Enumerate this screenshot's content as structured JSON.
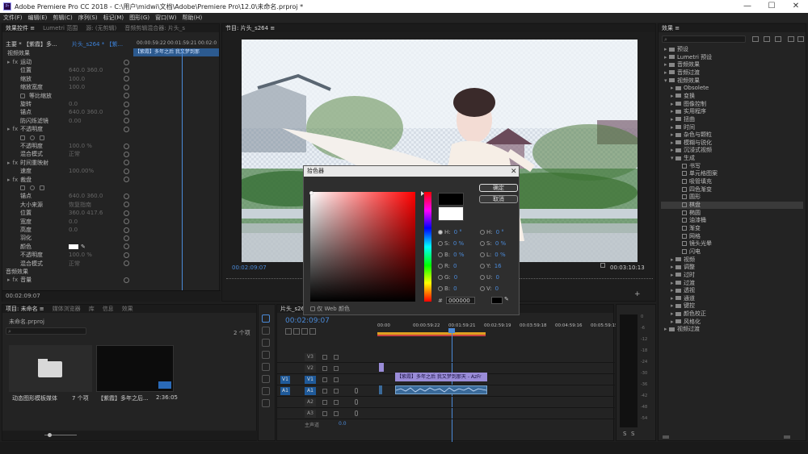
{
  "window": {
    "title": "Adobe Premiere Pro CC 2018 - C:\\用户\\midwi\\文档\\Adobe\\Premiere Pro\\12.0\\未命名.prproj *",
    "controls": [
      "—",
      "☐",
      "✕"
    ]
  },
  "menu": [
    "文件(F)",
    "编辑(E)",
    "剪辑(C)",
    "序列(S)",
    "标记(M)",
    "图形(G)",
    "窗口(W)",
    "帮助(H)"
  ],
  "effect_controls": {
    "tabs": [
      "效果控件 ≡",
      "Lumetri 范围",
      "源: (无剪辑)",
      "音频剪辑混合器: 片头_s"
    ],
    "header_left": "主要 * 【紫霞】多...",
    "header_right": "片头_s264 * 【紫...",
    "timecodes": [
      "00:00:59:22",
      "00:01:59:21",
      "00:02:0"
    ],
    "clip_label": "【紫霞】多年之后 我又梦到那",
    "section_video": "视频效果",
    "rows": [
      {
        "label": "运动",
        "value": "",
        "type": "group"
      },
      {
        "label": "位置",
        "value": "640.0    360.0",
        "type": "param"
      },
      {
        "label": "缩放",
        "value": "100.0",
        "type": "param"
      },
      {
        "label": "缩放宽度",
        "value": "100.0",
        "type": "param"
      },
      {
        "label": "等比缩放",
        "value": "",
        "type": "check"
      },
      {
        "label": "旋转",
        "value": "0.0",
        "type": "param"
      },
      {
        "label": "锚点",
        "value": "640.0    360.0",
        "type": "param"
      },
      {
        "label": "防闪烁滤镜",
        "value": "0.00",
        "type": "param"
      },
      {
        "label": "不透明度",
        "value": "",
        "type": "group"
      },
      {
        "label": "",
        "value": "",
        "type": "shapes"
      },
      {
        "label": "不透明度",
        "value": "100.0 %",
        "type": "param"
      },
      {
        "label": "混合模式",
        "value": "正常",
        "type": "param"
      },
      {
        "label": "时间重映射",
        "value": "",
        "type": "group"
      },
      {
        "label": "速度",
        "value": "100.00%",
        "type": "param"
      },
      {
        "label": "裁盘",
        "value": "",
        "type": "group"
      },
      {
        "label": "",
        "value": "",
        "type": "shapes"
      },
      {
        "label": "锚点",
        "value": "640.0    360.0",
        "type": "param"
      },
      {
        "label": "大小来源",
        "value": "恢复指南",
        "type": "param"
      },
      {
        "label": "位置",
        "value": "360.0    417.6",
        "type": "param"
      },
      {
        "label": "宽度",
        "value": "0.0",
        "type": "param"
      },
      {
        "label": "高度",
        "value": "0.0",
        "type": "param"
      },
      {
        "label": "羽化",
        "value": "",
        "type": "param"
      },
      {
        "label": "颜色",
        "value": "",
        "type": "color"
      },
      {
        "label": "不透明度",
        "value": "100.0 %",
        "type": "param"
      },
      {
        "label": "混合模式",
        "value": "正常",
        "type": "param"
      },
      {
        "label": "音频效果",
        "value": "",
        "type": "section"
      },
      {
        "label": "音量",
        "value": "",
        "type": "group"
      }
    ],
    "timecode": "00:02:09:07"
  },
  "program": {
    "tab": "节目: 片头_s264 ≡",
    "timecode_left": "00:02:09:07",
    "timecode_right": "00:03:10:13",
    "fit": "适合",
    "ratio": "完整"
  },
  "color_picker": {
    "title": "拾色器",
    "ok": "确定",
    "cancel": "取消",
    "fields": [
      {
        "k": "H:",
        "v": "0 °"
      },
      {
        "k": "S:",
        "v": "0 %"
      },
      {
        "k": "B:",
        "v": "0 %"
      },
      {
        "k": "R:",
        "v": "0"
      },
      {
        "k": "G:",
        "v": "0"
      },
      {
        "k": "B:",
        "v": "0"
      }
    ],
    "fields2": [
      {
        "k": "H:",
        "v": "0 °"
      },
      {
        "k": "S:",
        "v": "0 %"
      },
      {
        "k": "L:",
        "v": "0 %"
      },
      {
        "k": "Y:",
        "v": "16"
      },
      {
        "k": "U:",
        "v": "0"
      },
      {
        "k": "V:",
        "v": "0"
      }
    ],
    "hex_label": "#",
    "hex": "000000",
    "web_only": "仅 Web 颜色",
    "new_color": "#000000",
    "old_color": "#ffffff"
  },
  "project": {
    "tabs": [
      "项目: 未命名 ≡",
      "媒体浏览器",
      "库",
      "信息",
      "效果"
    ],
    "file": "未命名.prproj",
    "count": "2 个项",
    "items": [
      {
        "name": "动态图形模板媒体",
        "meta": "7 个项"
      },
      {
        "name": "【紫霞】多年之后...",
        "meta": "2:36:05"
      }
    ]
  },
  "timeline": {
    "tab": "片头_s264 ≡",
    "timecode": "00:02:09:07",
    "ruler": [
      "00:00",
      "00:00:59:22",
      "00:01:59:21",
      "00:02:59:19",
      "00:03:59:18",
      "00:04:59:16",
      "00:05:59:15"
    ],
    "video_tracks": [
      "V3",
      "V2",
      "V1"
    ],
    "audio_tracks": [
      "A1",
      "A2",
      "A3"
    ],
    "master": "主声道",
    "master_val": "0.0",
    "clip_video": "【紫霞】多年之后 我又梦到那天 - AzFr",
    "src_v": "V1",
    "src_a": "A1"
  },
  "effects": {
    "title": "效果 ≡",
    "items": [
      {
        "label": "预设",
        "indent": 0,
        "folder": true
      },
      {
        "label": "Lumetri 预设",
        "indent": 0,
        "folder": true
      },
      {
        "label": "音频效果",
        "indent": 0,
        "folder": true
      },
      {
        "label": "音频过渡",
        "indent": 0,
        "folder": true
      },
      {
        "label": "视频效果",
        "indent": 0,
        "folder": true
      },
      {
        "label": "Obsolete",
        "indent": 1,
        "folder": true
      },
      {
        "label": "变换",
        "indent": 1,
        "folder": true
      },
      {
        "label": "图像控制",
        "indent": 1,
        "folder": true
      },
      {
        "label": "实用程序",
        "indent": 1,
        "folder": true
      },
      {
        "label": "扭曲",
        "indent": 1,
        "folder": true
      },
      {
        "label": "时间",
        "indent": 1,
        "folder": true
      },
      {
        "label": "杂色与颗粒",
        "indent": 1,
        "folder": true
      },
      {
        "label": "模糊与锐化",
        "indent": 1,
        "folder": true
      },
      {
        "label": "沉浸式视频",
        "indent": 1,
        "folder": true
      },
      {
        "label": "生成",
        "indent": 1,
        "folder": true
      },
      {
        "label": "书写",
        "indent": 2,
        "folder": false
      },
      {
        "label": "单元格图案",
        "indent": 2,
        "folder": false
      },
      {
        "label": "吸管填充",
        "indent": 2,
        "folder": false
      },
      {
        "label": "四色渐变",
        "indent": 2,
        "folder": false
      },
      {
        "label": "圆形",
        "indent": 2,
        "folder": false
      },
      {
        "label": "棋盘",
        "indent": 2,
        "folder": false,
        "selected": true
      },
      {
        "label": "椭圆",
        "indent": 2,
        "folder": false
      },
      {
        "label": "油漆桶",
        "indent": 2,
        "folder": false
      },
      {
        "label": "渐变",
        "indent": 2,
        "folder": false
      },
      {
        "label": "网格",
        "indent": 2,
        "folder": false
      },
      {
        "label": "镜头光晕",
        "indent": 2,
        "folder": false
      },
      {
        "label": "闪电",
        "indent": 2,
        "folder": false
      },
      {
        "label": "视频",
        "indent": 1,
        "folder": true
      },
      {
        "label": "调整",
        "indent": 1,
        "folder": true
      },
      {
        "label": "过时",
        "indent": 1,
        "folder": true
      },
      {
        "label": "过渡",
        "indent": 1,
        "folder": true
      },
      {
        "label": "透视",
        "indent": 1,
        "folder": true
      },
      {
        "label": "通道",
        "indent": 1,
        "folder": true
      },
      {
        "label": "键控",
        "indent": 1,
        "folder": true
      },
      {
        "label": "颜色校正",
        "indent": 1,
        "folder": true
      },
      {
        "label": "风格化",
        "indent": 1,
        "folder": true
      },
      {
        "label": "视频过渡",
        "indent": 0,
        "folder": true
      }
    ]
  },
  "audio_meter": {
    "labels": [
      "0",
      "-6",
      "-12",
      "-18",
      "-24",
      "-30",
      "-36",
      "-42",
      "-48",
      "-54"
    ],
    "foot": [
      "S",
      "S"
    ]
  }
}
